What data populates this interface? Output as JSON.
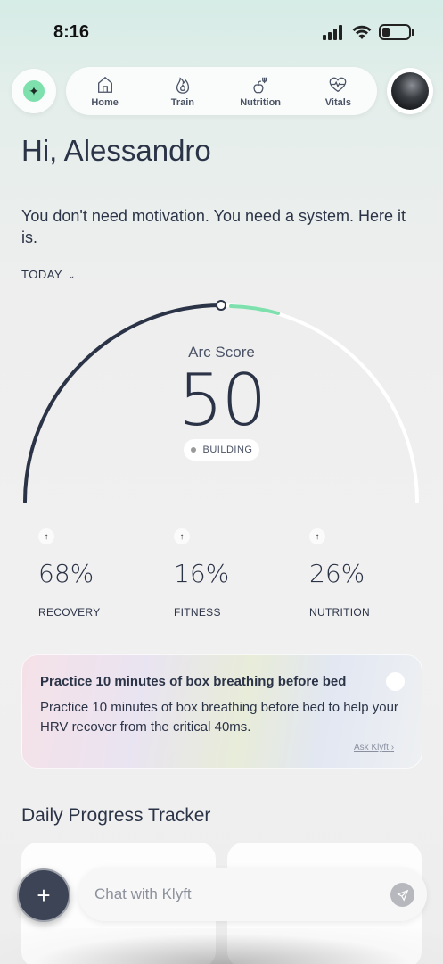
{
  "status_bar": {
    "time": "8:16"
  },
  "nav": {
    "items": [
      {
        "label": "Home",
        "icon": "home-icon"
      },
      {
        "label": "Train",
        "icon": "flame-icon"
      },
      {
        "label": "Nutrition",
        "icon": "nutrition-icon"
      },
      {
        "label": "Vitals",
        "icon": "heart-pulse-icon"
      }
    ]
  },
  "greeting": "Hi, Alessandro",
  "motto": "You don't need motivation. You need a system. Here it is.",
  "period": {
    "label": "TODAY"
  },
  "score": {
    "label": "Arc Score",
    "value": "50",
    "status": "BUILDING",
    "fraction": 0.5,
    "accent_color": "#7de0ad"
  },
  "stats": [
    {
      "value": "68%",
      "label": "RECOVERY",
      "trend": "up"
    },
    {
      "value": "16%",
      "label": "FITNESS",
      "trend": "up"
    },
    {
      "value": "26%",
      "label": "NUTRITION",
      "trend": "up"
    }
  ],
  "tip": {
    "title": "Practice 10 minutes of box breathing before bed",
    "body": "Practice 10 minutes of box breathing before bed to help your HRV recover from the critical 40ms.",
    "link": "Ask Klyft"
  },
  "tracker": {
    "title": "Daily Progress Tracker"
  },
  "chat": {
    "placeholder": "Chat with Klyft"
  },
  "colors": {
    "primary": "#2b3347",
    "accent": "#7de0ad",
    "fab": "#3d4456"
  }
}
